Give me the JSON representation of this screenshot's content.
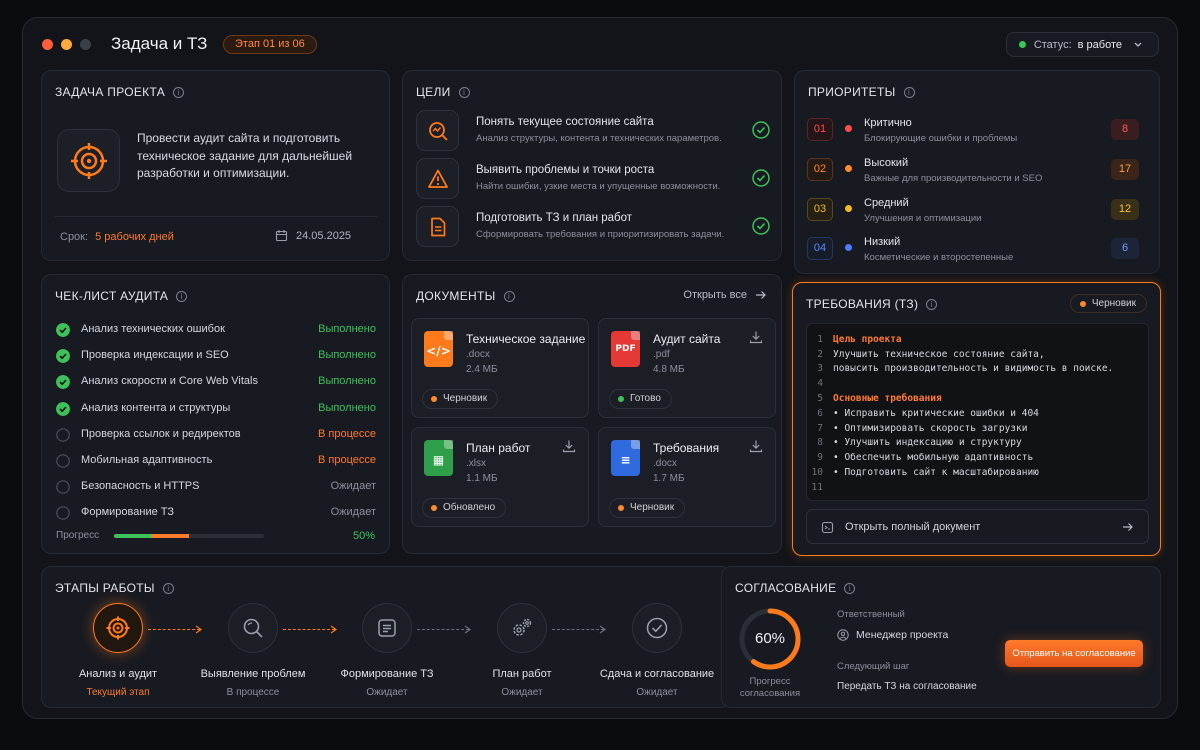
{
  "window": {
    "title": "Задача и ТЗ",
    "stage_badge": "Этап 01 из 06",
    "status_label": "Статус:",
    "status_value": "в работе"
  },
  "task": {
    "title": "ЗАДАЧА ПРОЕКТА",
    "description": "Провести аудит сайта и подготовить техническое задание для дальнейшей разработки и оптимизации.",
    "deadline_label": "Срок:",
    "deadline_value": "5 рабочих дней",
    "date": "24.05.2025"
  },
  "goals": {
    "title": "ЦЕЛИ",
    "items": [
      {
        "title": "Понять текущее состояние сайта",
        "sub": "Анализ структуры, контента и технических параметров.",
        "icon": "chart-search-icon"
      },
      {
        "title": "Выявить проблемы и точки роста",
        "sub": "Найти ошибки, узкие места и упущенные возможности.",
        "icon": "warning-icon"
      },
      {
        "title": "Подготовить ТЗ и план работ",
        "sub": "Сформировать требования и приоритизировать задачи.",
        "icon": "document-icon"
      }
    ]
  },
  "priorities": {
    "title": "ПРИОРИТЕТЫ",
    "items": [
      {
        "num": "01",
        "title": "Критично",
        "sub": "Блокирующие ошибки и проблемы",
        "count": "8",
        "color": "#ff4d4d"
      },
      {
        "num": "02",
        "title": "Высокий",
        "sub": "Важные для производительности и SEO",
        "count": "17",
        "color": "#ff8a2a"
      },
      {
        "num": "03",
        "title": "Средний",
        "sub": "Улучшения и оптимизации",
        "count": "12",
        "color": "#f5b82a"
      },
      {
        "num": "04",
        "title": "Низкий",
        "sub": "Косметические и второстепенные",
        "count": "6",
        "color": "#4d7dff"
      }
    ]
  },
  "checklist": {
    "title": "ЧЕК-ЛИСТ АУДИТА",
    "items": [
      {
        "label": "Анализ технических ошибок",
        "status": "Выполнено",
        "state": "done"
      },
      {
        "label": "Проверка индексации и SEO",
        "status": "Выполнено",
        "state": "done"
      },
      {
        "label": "Анализ скорости и Core Web Vitals",
        "status": "Выполнено",
        "state": "done"
      },
      {
        "label": "Анализ контента и структуры",
        "status": "Выполнено",
        "state": "done"
      },
      {
        "label": "Проверка ссылок и редиректов",
        "status": "В процессе",
        "state": "progress"
      },
      {
        "label": "Мобильная адаптивность",
        "status": "В процессе",
        "state": "progress"
      },
      {
        "label": "Безопасность и HTTPS",
        "status": "Ожидает",
        "state": "wait"
      },
      {
        "label": "Формирование ТЗ",
        "status": "Ожидает",
        "state": "wait"
      }
    ],
    "progress_label": "Прогресс",
    "progress_value": "50%",
    "progress_fraction": 0.5
  },
  "documents": {
    "title": "ДОКУМЕНТЫ",
    "open_all": "Открыть все",
    "items": [
      {
        "name": "Техническое задание",
        "ext": ".docx",
        "size": "2.4 МБ",
        "tag": "Черновик",
        "tag_color": "#ff8a2a",
        "icon_color": "#ff7a1a",
        "icon": "code-file-icon",
        "glyph": "</>"
      },
      {
        "name": "Аудит сайта",
        "ext": ".pdf",
        "size": "4.8 МБ",
        "tag": "Готово",
        "tag_color": "#3ec15a",
        "icon_color": "#e53935",
        "icon": "pdf-file-icon",
        "glyph": "PDF"
      },
      {
        "name": "План работ",
        "ext": ".xlsx",
        "size": "1.1 МБ",
        "tag": "Обновлено",
        "tag_color": "#ff8a2a",
        "icon_color": "#2e9e48",
        "icon": "sheet-file-icon",
        "glyph": "▦"
      },
      {
        "name": "Требования",
        "ext": ".docx",
        "size": "1.7 МБ",
        "tag": "Черновик",
        "tag_color": "#ff8a2a",
        "icon_color": "#2f6bde",
        "icon": "doc-file-icon",
        "glyph": "≡"
      }
    ]
  },
  "requirements": {
    "title": "ТРЕБОВАНИЯ (ТЗ)",
    "badge": "Черновик",
    "lines": [
      {
        "n": "1",
        "t": "Цель проекта",
        "h": true
      },
      {
        "n": "2",
        "t": "Улучшить техническое состояние сайта,",
        "h": false
      },
      {
        "n": "3",
        "t": "повысить производительность и видимость в поиске.",
        "h": false
      },
      {
        "n": "4",
        "t": "",
        "h": false
      },
      {
        "n": "5",
        "t": "Основные требования",
        "h": true
      },
      {
        "n": "6",
        "t": "• Исправить критические ошибки и 404",
        "h": false
      },
      {
        "n": "7",
        "t": "• Оптимизировать скорость загрузки",
        "h": false
      },
      {
        "n": "8",
        "t": "• Улучшить индексацию и структуру",
        "h": false
      },
      {
        "n": "9",
        "t": "• Обеспечить мобильную адаптивность",
        "h": false
      },
      {
        "n": "10",
        "t": "• Подготовить сайт к масштабированию",
        "h": false
      },
      {
        "n": "11",
        "t": "",
        "h": false
      }
    ],
    "open_full": "Открыть полный документ"
  },
  "stages": {
    "title": "ЭТАПЫ РАБОТЫ",
    "items": [
      {
        "name": "Анализ и аудит",
        "status": "Текущий этап",
        "icon": "target-icon",
        "active": true
      },
      {
        "name": "Выявление проблем",
        "status": "В процессе",
        "icon": "search-icon",
        "active": false
      },
      {
        "name": "Формирование ТЗ",
        "status": "Ожидает",
        "icon": "list-icon",
        "active": false
      },
      {
        "name": "План работ",
        "status": "Ожидает",
        "icon": "gears-icon",
        "active": false
      },
      {
        "name": "Сдача и согласование",
        "status": "Ожидает",
        "icon": "check-circle-icon",
        "active": false
      }
    ]
  },
  "approval": {
    "title": "СОГЛАСОВАНИЕ",
    "percent": "60%",
    "fraction": 0.6,
    "progress_caption_1": "Прогресс",
    "progress_caption_2": "согласования",
    "responsible_label": "Ответственный",
    "responsible_value": "Менеджер проекта",
    "next_label": "Следующий шаг",
    "next_value": "Передать ТЗ на согласование",
    "button": "Отправить на согласование"
  },
  "colors": {
    "accent": "#ff7a2a",
    "success": "#3ec15a",
    "background": "#121419"
  }
}
